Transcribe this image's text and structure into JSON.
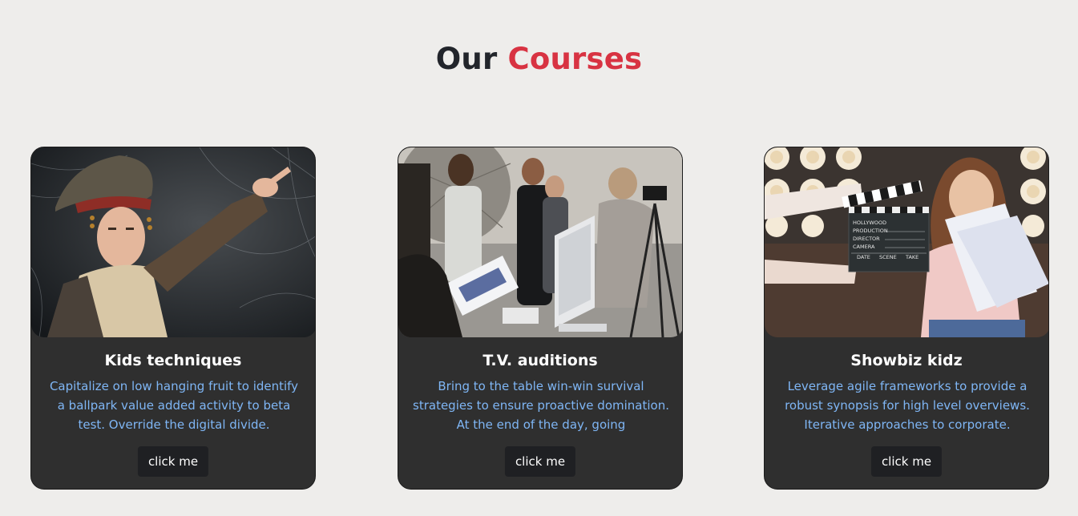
{
  "header": {
    "title_part1": "Our",
    "title_part2": "Courses"
  },
  "colors": {
    "background": "#eeedeb",
    "title_dark": "#22252b",
    "title_accent": "#d83342",
    "card_bg": "#2f2f2f",
    "card_text": "#7fb6f5",
    "button_bg": "#1f2023"
  },
  "courses": [
    {
      "title": "Kids techniques",
      "description": "Capitalize on low hanging fruit to identify a ballpark value added activity to beta test. Override the digital divide.",
      "button_label": "click me",
      "image": "kid-pirate-costume-photo"
    },
    {
      "title": "T.V. auditions",
      "description": "Bring to the table win-win survival strategies to ensure proactive domination. At the end of the day, going",
      "button_label": "click me",
      "image": "film-crew-set-photo"
    },
    {
      "title": "Showbiz kidz",
      "description": "Leverage agile frameworks to provide a robust synopsis for high level overviews. Iterative approaches to corporate.",
      "button_label": "click me",
      "image": "girl-with-clapperboard-photo",
      "clapperboard_lines": [
        "HOLLYWOOD",
        "PRODUCTION",
        "DIRECTOR",
        "CAMERA",
        "DATE",
        "SCENE",
        "TAKE"
      ]
    }
  ]
}
